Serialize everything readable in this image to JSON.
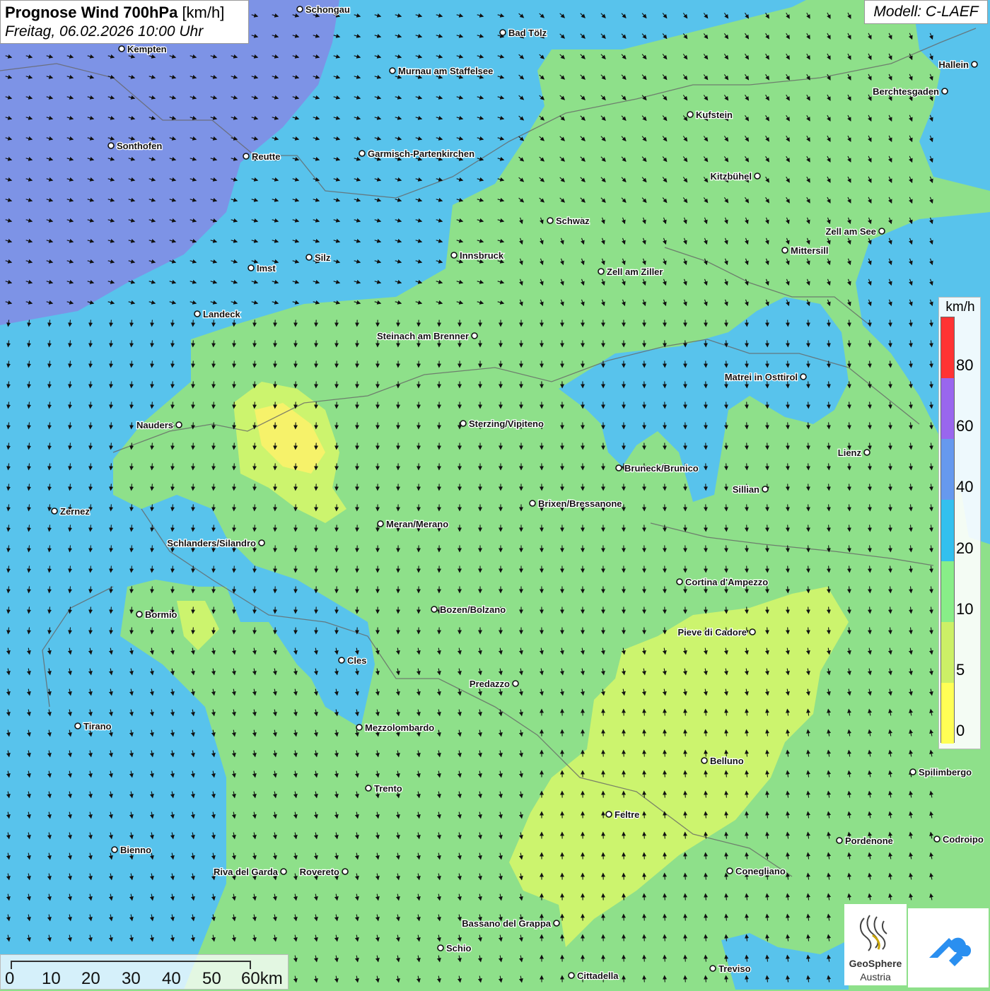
{
  "header": {
    "title_bold": "Prognose Wind 700hPa",
    "title_unit": "[km/h]",
    "subtitle": "Freitag, 06.02.2026 10:00 Uhr",
    "model": "Modell: C-LAEF"
  },
  "legend": {
    "unit": "km/h",
    "levels": [
      {
        "label": "80",
        "color": "#ff3333"
      },
      {
        "label": "60",
        "color": "#9966ee"
      },
      {
        "label": "40",
        "color": "#6699ee"
      },
      {
        "label": "20",
        "color": "#33c0ee"
      },
      {
        "label": "10",
        "color": "#88ee88"
      },
      {
        "label": "5",
        "color": "#ccf066"
      },
      {
        "label": "0",
        "color": "#ffff55"
      }
    ]
  },
  "scalebar": {
    "labels": [
      "0",
      "10",
      "20",
      "30",
      "40",
      "50",
      "60km"
    ]
  },
  "logo": {
    "name": "GeoSphere",
    "sub": "Austria",
    "icon": "geosphere-logo"
  },
  "colors": {
    "wind_0_5": "#f6f26a",
    "wind_5_10": "#ccf46e",
    "wind_10_20": "#8ee08a",
    "wind_20_40": "#58c3ec",
    "wind_40_60": "#7d93e6",
    "arrow": "#111111",
    "border": "#666666"
  },
  "cities": [
    {
      "name": "Schongau",
      "side": "right"
    },
    {
      "name": "Bad Tölz",
      "side": "right"
    },
    {
      "name": "Kempten",
      "side": "right"
    },
    {
      "name": "Murnau am Staffelsee",
      "side": "right"
    },
    {
      "name": "Hallein",
      "side": "left"
    },
    {
      "name": "Berchtesgaden",
      "side": "left"
    },
    {
      "name": "Kufstein",
      "side": "right"
    },
    {
      "name": "Sonthofen",
      "side": "right"
    },
    {
      "name": "Reutte",
      "side": "right"
    },
    {
      "name": "Garmisch-Partenkirchen",
      "side": "right"
    },
    {
      "name": "Kitzbühel",
      "side": "left"
    },
    {
      "name": "Schwaz",
      "side": "right"
    },
    {
      "name": "Zell am See",
      "side": "left"
    },
    {
      "name": "Innsbruck",
      "side": "right"
    },
    {
      "name": "Mittersill",
      "side": "right"
    },
    {
      "name": "Silz",
      "side": "right"
    },
    {
      "name": "Imst",
      "side": "right"
    },
    {
      "name": "Zell am Ziller",
      "side": "right"
    },
    {
      "name": "Landeck",
      "side": "right"
    },
    {
      "name": "Steinach am Brenner",
      "side": "left"
    },
    {
      "name": "Matrei in Osttirol",
      "side": "left"
    },
    {
      "name": "Nauders",
      "side": "left"
    },
    {
      "name": "Sterzing/Vipiteno",
      "side": "right"
    },
    {
      "name": "Lienz",
      "side": "left"
    },
    {
      "name": "Bruneck/Brunico",
      "side": "right"
    },
    {
      "name": "Sillian",
      "side": "left"
    },
    {
      "name": "Brixen/Bressanone",
      "side": "right"
    },
    {
      "name": "Zernez",
      "side": "right"
    },
    {
      "name": "Meran/Merano",
      "side": "right"
    },
    {
      "name": "Schlanders/Silandro",
      "side": "left"
    },
    {
      "name": "Cortina d'Ampezzo",
      "side": "right"
    },
    {
      "name": "Bozen/Bolzano",
      "side": "right"
    },
    {
      "name": "Bormio",
      "side": "right"
    },
    {
      "name": "Pieve di Cadore",
      "side": "left"
    },
    {
      "name": "Cles",
      "side": "right"
    },
    {
      "name": "Predazzo",
      "side": "left"
    },
    {
      "name": "Tirano",
      "side": "right"
    },
    {
      "name": "Mezzolombardo",
      "side": "right"
    },
    {
      "name": "Belluno",
      "side": "right"
    },
    {
      "name": "Spilimbergo",
      "side": "right"
    },
    {
      "name": "Trento",
      "side": "right"
    },
    {
      "name": "Feltre",
      "side": "right"
    },
    {
      "name": "Pordenone",
      "side": "right"
    },
    {
      "name": "Codroipo",
      "side": "right"
    },
    {
      "name": "Bienno",
      "side": "right"
    },
    {
      "name": "Riva del Garda",
      "side": "left"
    },
    {
      "name": "Rovereto",
      "side": "left"
    },
    {
      "name": "Conegliano",
      "side": "right"
    },
    {
      "name": "Bassano del Grappa",
      "side": "left"
    },
    {
      "name": "Schio",
      "side": "right"
    },
    {
      "name": "Treviso",
      "side": "right"
    },
    {
      "name": "Cittadella",
      "side": "right"
    }
  ]
}
